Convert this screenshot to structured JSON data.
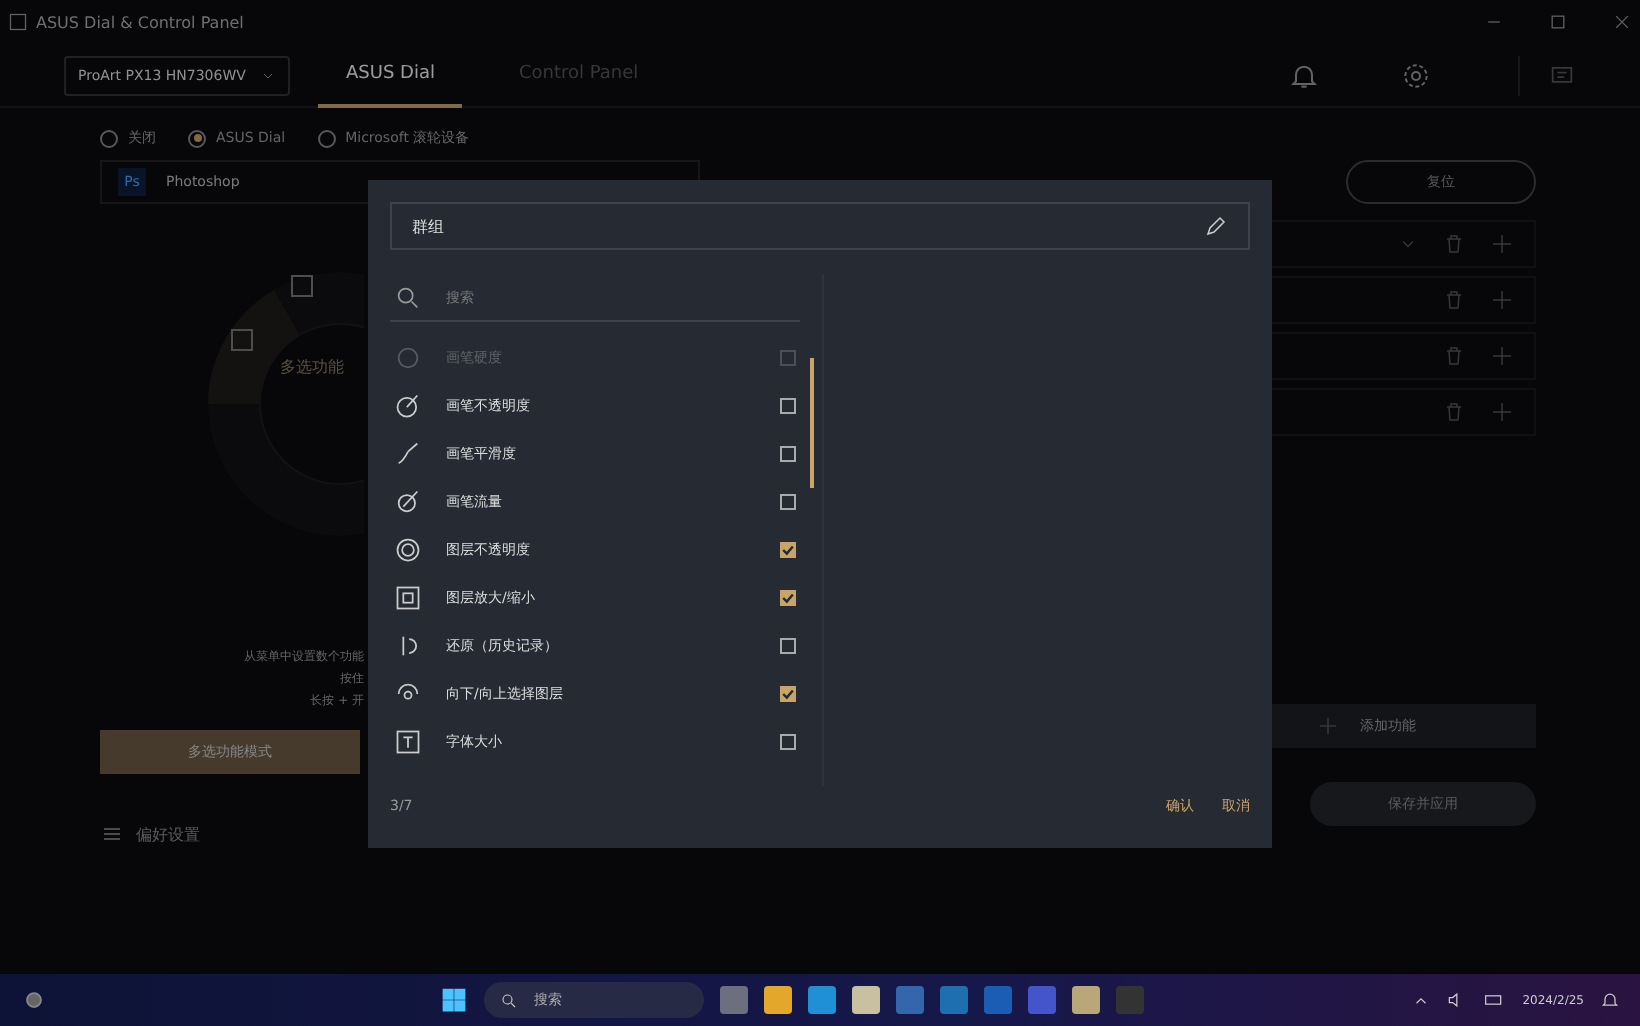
{
  "window": {
    "title": "ASUS Dial & Control Panel"
  },
  "device_select": {
    "value": "ProArt PX13 HN7306WV"
  },
  "tabs": [
    {
      "label": "ASUS Dial",
      "selected": true
    },
    {
      "label": "Control Panel",
      "selected": false
    }
  ],
  "modes": [
    {
      "label": "关闭",
      "selected": false
    },
    {
      "label": "ASUS Dial",
      "selected": true
    },
    {
      "label": "Microsoft 滚轮设备",
      "selected": false
    }
  ],
  "app_select": {
    "badge": "Ps",
    "value": "Photoshop"
  },
  "dial": {
    "center_label": "多选功能"
  },
  "hints": [
    "从菜单中设置数个功能",
    "按住",
    "长按 + 开"
  ],
  "mode_button": "多选功能模式",
  "preferences": "偏好设置",
  "reset_button": "复位",
  "function_rows": [
    {
      "kind": "dropdown"
    },
    {
      "kind": "plain"
    },
    {
      "kind": "plain"
    },
    {
      "kind": "plain"
    }
  ],
  "add_button": "添加功能",
  "save_button": "保存并应用",
  "dialog": {
    "title_value": "群组",
    "search_placeholder": "搜索",
    "items": [
      {
        "label": "画笔硬度",
        "checked": false,
        "disabled": true
      },
      {
        "label": "画笔不透明度",
        "checked": false,
        "disabled": false
      },
      {
        "label": "画笔平滑度",
        "checked": false,
        "disabled": false
      },
      {
        "label": "画笔流量",
        "checked": false,
        "disabled": false
      },
      {
        "label": "图层不透明度",
        "checked": true,
        "disabled": false
      },
      {
        "label": "图层放大/缩小",
        "checked": true,
        "disabled": false
      },
      {
        "label": "还原（历史记录）",
        "checked": false,
        "disabled": false
      },
      {
        "label": "向下/向上选择图层",
        "checked": true,
        "disabled": false
      },
      {
        "label": "字体大小",
        "checked": false,
        "disabled": false
      }
    ],
    "count": "3/7",
    "confirm": "确认",
    "cancel": "取消"
  },
  "taskbar": {
    "search_placeholder": "搜索",
    "date": "2024/2/25"
  }
}
